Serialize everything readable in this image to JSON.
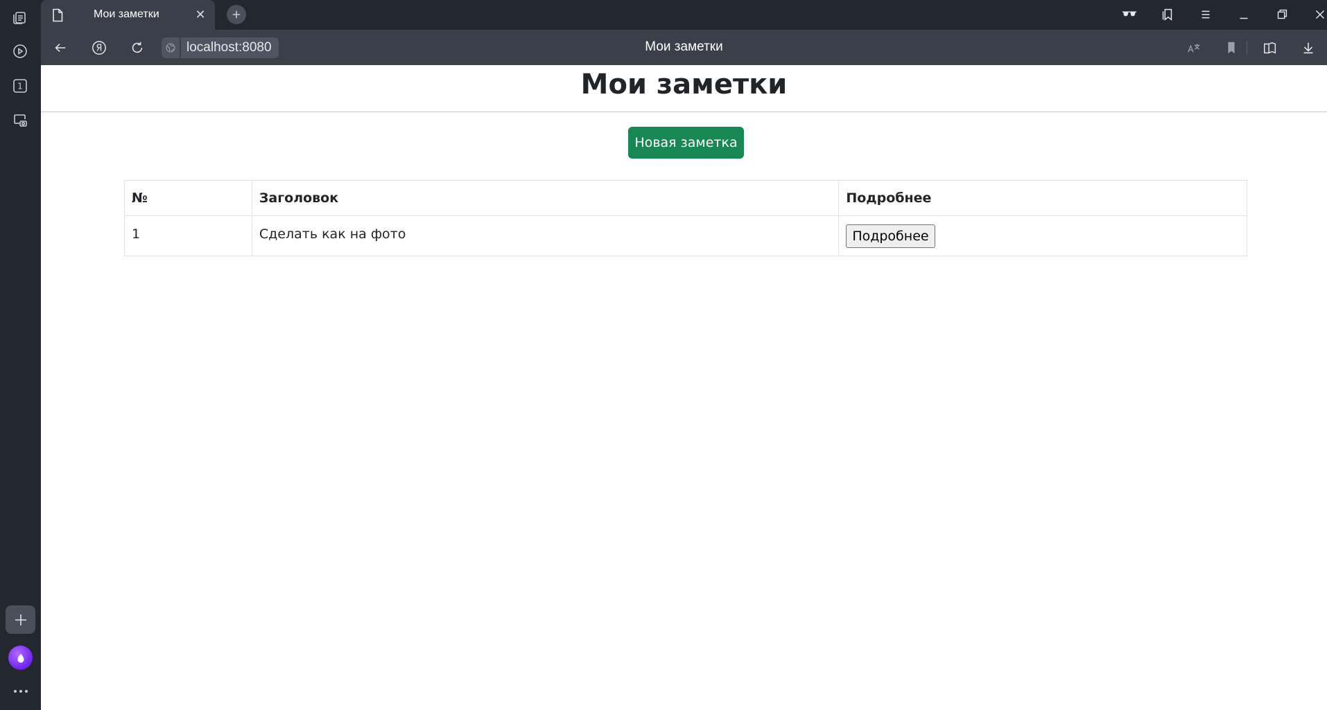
{
  "browser": {
    "tab": {
      "title": "Мои заметки"
    },
    "address": {
      "url": "localhost:8080"
    },
    "page_title": "Мои заметки",
    "sidebar_tab_count": "1"
  },
  "page": {
    "heading": "Мои заметки",
    "new_note_button": "Новая заметка",
    "table": {
      "headers": [
        "№",
        "Заголовок",
        "Подробнее"
      ],
      "rows": [
        {
          "num": "1",
          "title": "Сделать как на фото",
          "action": "Подробнее"
        }
      ]
    }
  },
  "colors": {
    "chrome_dark": "#23272f",
    "chrome_mid": "#3b3f4a",
    "success_green": "#198754"
  }
}
